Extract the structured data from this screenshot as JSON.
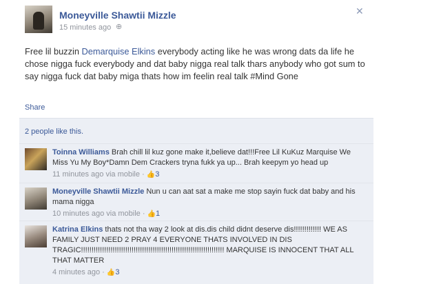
{
  "post": {
    "author": "Moneyville Shawtii Mizzle",
    "time": "15 minutes ago",
    "close_icon": "✕",
    "globe_icon": "globe-icon",
    "text_before": "Free lil buzzin ",
    "tagged_name": "Demarquise Elkins",
    "text_after": " everybody acting like he was wrong dats da life he chose nigga fuck everybody and dat baby nigga real talk thars anybody who got sum to say nigga fuck dat baby miga thats how im feelin real talk #Mind Gone"
  },
  "feedback": {
    "share_label": "Share",
    "likes_label": "2 people like this."
  },
  "comments": [
    {
      "author": "Toinna Williams",
      "text": "Brah chill lil kuz gone make it,believe dat!!!Free Lil KuKuz Marquise We Miss Yu My Boy*Damn Dem Crackers tryna fukk ya up... Brah keepym yo head up",
      "time": "11 minutes ago via mobile",
      "likes": "3"
    },
    {
      "author": "Moneyville Shawtii Mizzle",
      "text": "Nun u can aat sat a make me stop sayin fuck dat baby and his mama nigga",
      "time": "10 minutes ago via mobile",
      "likes": "1"
    },
    {
      "author": "Katrina Elkins",
      "text": "thats not tha way 2 look at dis.dis child didnt deserve dis!!!!!!!!!!!!! WE AS FAMILY JUST NEED 2 PRAY 4 EVERYONE THATS INVOLVED IN DIS TRAGIC!!!!!!!!!!!!!!!!!!!!!!!!!!!!!!!!!!!!!!!!!!!!!!!!!!!!!!!!!!!!!!!!!!!! MARQUISE IS INNOCENT THAT ALL THAT MATTER",
      "time": "4 minutes ago",
      "likes": "3"
    }
  ],
  "colors": {
    "link": "#3b5998",
    "feedback_bg": "#eceff5",
    "meta": "#90949c"
  }
}
